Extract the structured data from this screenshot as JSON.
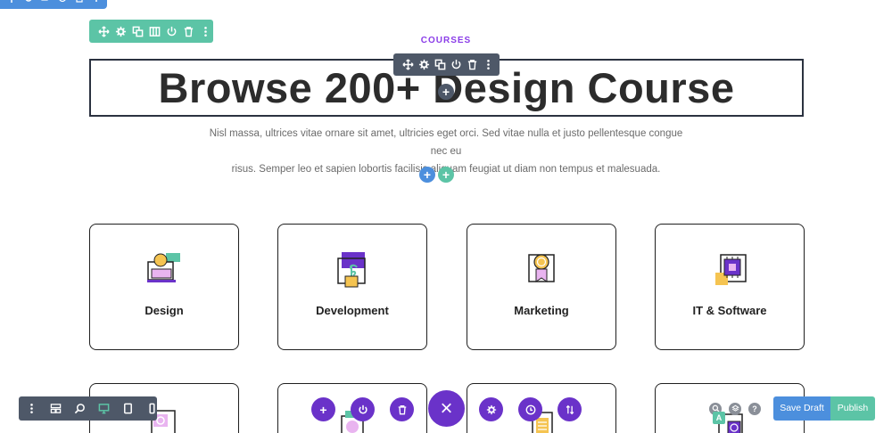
{
  "section_toolbar": {
    "icons": [
      "move-icon",
      "gear-icon",
      "duplicate-icon",
      "columns-icon",
      "power-icon",
      "trash-icon",
      "more-icon"
    ]
  },
  "module_toolbar": {
    "icons": [
      "move-icon",
      "gear-icon",
      "duplicate-icon",
      "power-icon",
      "trash-icon",
      "more-icon"
    ]
  },
  "header": {
    "eyebrow": "COURSES",
    "title": "Browse 200+ Design Course",
    "description_line1": "Nisl massa, ultrices vitae ornare sit amet, ultricies eget orci. Sed vitae nulla et justo pellentesque congue nec eu",
    "description_line2": "risus. Semper leo et sapien lobortis facilisis aliquam feugiat ut diam non tempus et malesuada."
  },
  "add_buttons": {
    "plus": "+"
  },
  "cards": [
    {
      "label": "Design",
      "icon": "design-icon"
    },
    {
      "label": "Development",
      "icon": "development-icon"
    },
    {
      "label": "Marketing",
      "icon": "marketing-icon"
    },
    {
      "label": "IT & Software",
      "icon": "it-software-icon"
    }
  ],
  "view_toolbar": {
    "icons": [
      "more-icon",
      "wireframe-icon",
      "zoom-icon",
      "desktop-icon",
      "tablet-icon",
      "phone-icon"
    ]
  },
  "builder_actions": {
    "close": "×",
    "plus": "+"
  },
  "hints": {
    "help": "?",
    "badge": "A"
  },
  "footer": {
    "save_label": "Save Draft",
    "publish_label": "Publish"
  },
  "colors": {
    "blue": "#4c8fdd",
    "green": "#5cc4a6",
    "purple": "#6a32c9",
    "dark": "#4e5868",
    "accent": "#8a3ce8"
  }
}
